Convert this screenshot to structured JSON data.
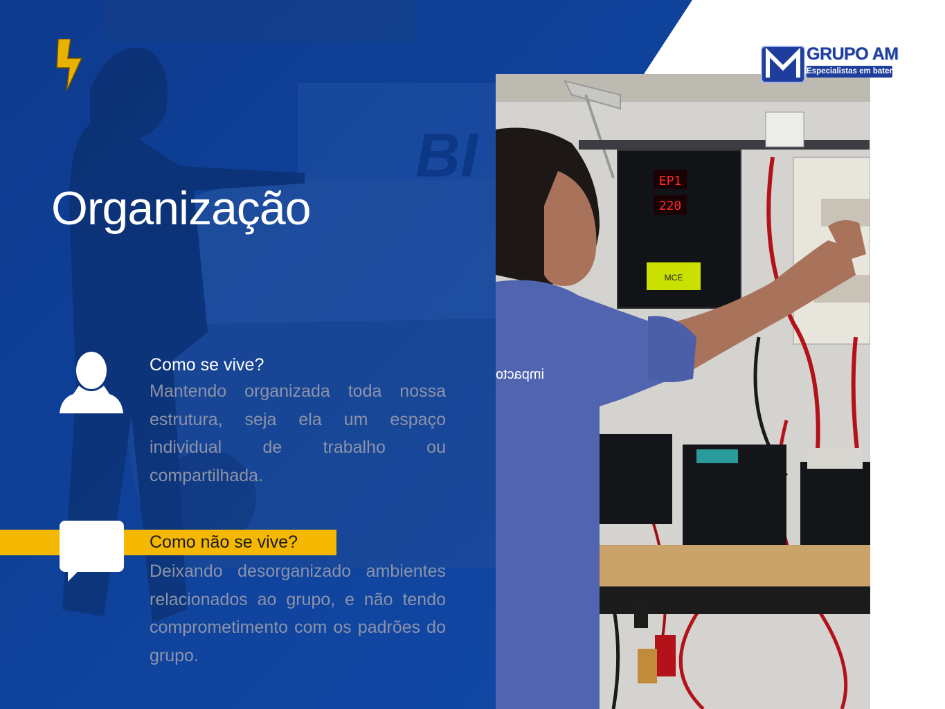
{
  "slide": {
    "title": "Organização",
    "items": [
      {
        "heading": "Como se vive?",
        "body": "Mantendo organizada toda nossa estrutura, seja ela um espaço individual de trabalho ou compartilhada.",
        "icon": "person-icon"
      },
      {
        "heading": "Como não se vive?",
        "body": "Deixando desorganizado ambientes relacionados ao grupo, e não tendo comprometimento com os padrões do grupo.",
        "icon": "chat-bubble-icon"
      }
    ]
  },
  "logo": {
    "name": "GRUPO AM",
    "tagline": "Especialistas em baterias"
  },
  "photo": {
    "panel_readout_top": "EP1",
    "panel_readout_bottom": "220",
    "panel_label": "MCE",
    "shirt_text": "impacto"
  },
  "colors": {
    "primary_blue": "#0f3f96",
    "accent_yellow": "#f5b800",
    "body_text": "#8c93a8",
    "white": "#ffffff"
  }
}
